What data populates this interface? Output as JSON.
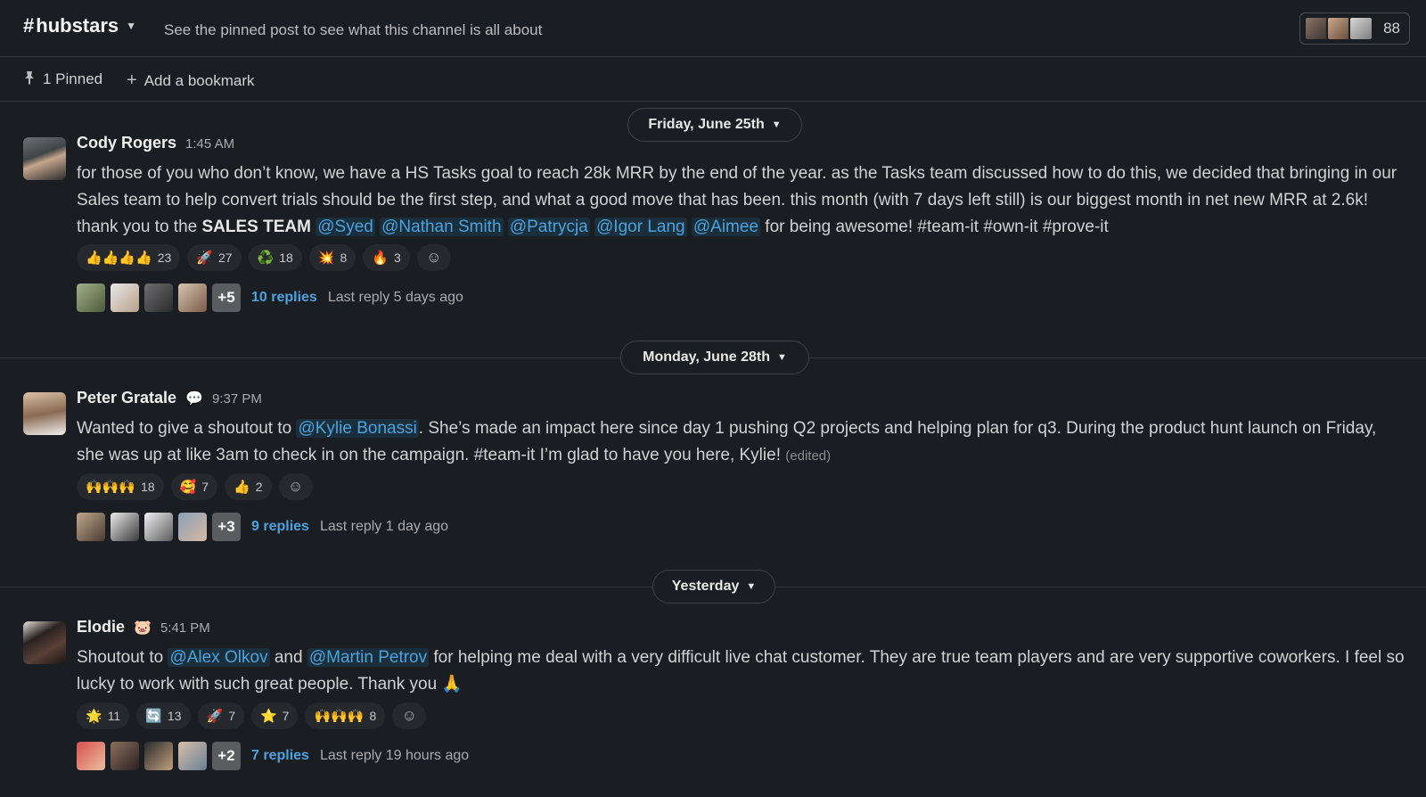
{
  "header": {
    "channel_hash": "#",
    "channel_name": "hubstars",
    "topic": "See the pinned post to see what this channel is all about",
    "member_count": "88"
  },
  "bookmarks": {
    "pinned_label": "1 Pinned",
    "add_bookmark_label": "Add a bookmark"
  },
  "days": [
    {
      "label": "Friday, June 25th"
    },
    {
      "label": "Monday, June 28th"
    },
    {
      "label": "Yesterday"
    }
  ],
  "messages": [
    {
      "author": "Cody Rogers",
      "status_emoji": "",
      "time": "1:45 AM",
      "text_parts": {
        "p1": "for those of you who don’t know, we have a HS Tasks goal to reach 28k MRR by the end of the year. as the Tasks team discussed how to do this, we decided that bringing in our Sales team to help convert trials should be the first step, and what a good move that has been. this month (with 7 days left still) is our biggest month in net new MRR at 2.6k! thank you to the ",
        "bold": "SALES TEAM",
        "m1": "@Syed",
        "m2": "@Nathan Smith",
        "m3": "@Patrycja",
        "m4": "@Igor Lang",
        "m5": "@Aimee",
        "p2": " for being awesome! #team-it #own-it #prove-it"
      },
      "reactions": [
        {
          "emoji": "👍👍👍👍",
          "count": "23"
        },
        {
          "emoji": "🚀",
          "count": "27"
        },
        {
          "emoji": "♻️",
          "count": "18"
        },
        {
          "emoji": "💥",
          "count": "8"
        },
        {
          "emoji": "🔥",
          "count": "3"
        }
      ],
      "thread": {
        "more": "+5",
        "replies": "10 replies",
        "last_reply": "Last reply 5 days ago"
      }
    },
    {
      "author": "Peter Gratale",
      "status_emoji": "💬",
      "time": "9:37 PM",
      "text_parts": {
        "p1": "Wanted to give a shoutout to ",
        "m1": "@Kylie Bonassi",
        "p2": ". She’s made an impact here since day 1 pushing Q2 projects and helping plan for q3. During the product hunt launch on Friday, she was up at like 3am to check in on the campaign. #team-it I’m glad to have you here, Kylie! ",
        "edited": "(edited)"
      },
      "reactions": [
        {
          "emoji": "🙌🙌🙌",
          "count": "18"
        },
        {
          "emoji": "🥰",
          "count": "7"
        },
        {
          "emoji": "👍",
          "count": "2"
        }
      ],
      "thread": {
        "more": "+3",
        "replies": "9 replies",
        "last_reply": "Last reply 1 day ago"
      }
    },
    {
      "author": "Elodie",
      "status_emoji": "🐷",
      "time": "5:41 PM",
      "text_parts": {
        "p1": "Shoutout to ",
        "m1": "@Alex Olkov",
        "p2": " and ",
        "m2": "@Martin Petrov",
        "p3": " for helping me deal with a very difficult live chat customer. They are true team players and are very supportive coworkers. I feel so lucky to work with such great people. Thank you ",
        "emoji": "🙏"
      },
      "reactions": [
        {
          "emoji": "🌟",
          "count": "11"
        },
        {
          "emoji": "🔄",
          "count": "13"
        },
        {
          "emoji": "🚀",
          "count": "7"
        },
        {
          "emoji": "⭐",
          "count": "7"
        },
        {
          "emoji": "🙌🙌🙌",
          "count": "8"
        }
      ],
      "thread": {
        "more": "+2",
        "replies": "7 replies",
        "last_reply": "Last reply 19 hours ago"
      }
    }
  ],
  "icons": {
    "chevron": "⌄",
    "pin": "📌",
    "plus": "+",
    "add_reaction": "☺"
  },
  "colors": {
    "background": "#1a1d21",
    "mention": "#4aa3df",
    "link": "#4aa3df"
  }
}
